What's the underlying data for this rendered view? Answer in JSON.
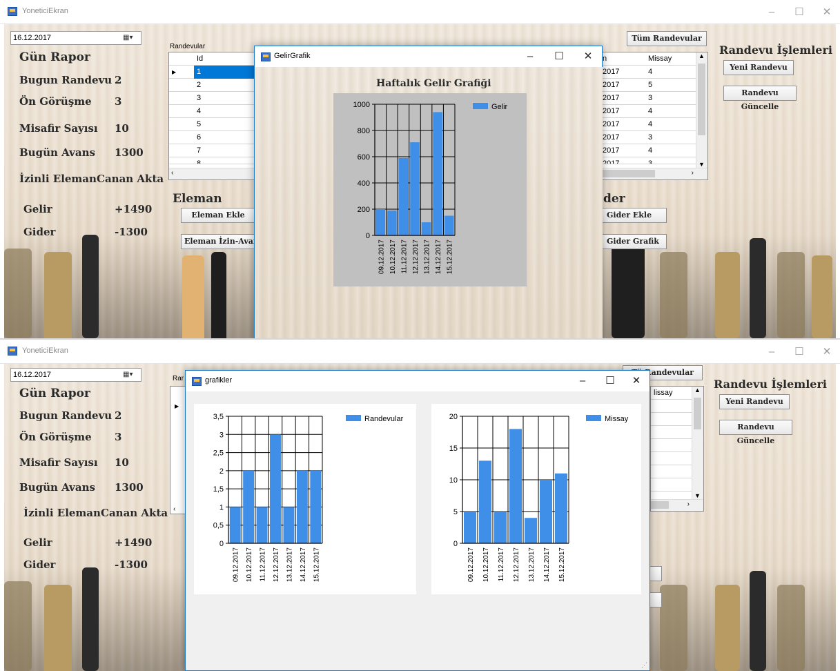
{
  "top": {
    "app_title": "YoneticiEkran",
    "date": "16.12.2017",
    "gun_rapor": "Gün Rapor",
    "stats": [
      {
        "label": "Bugun Randevu",
        "value": "2"
      },
      {
        "label": "Ön Görüşme",
        "value": "3"
      },
      {
        "label": "Misafir Sayısı",
        "value": "10"
      },
      {
        "label": "Bugün Avans",
        "value": "1300"
      },
      {
        "label": "İzinli Eleman",
        "value": "Canan Akta"
      },
      {
        "label": "Gelir",
        "value": "+1490"
      },
      {
        "label": "Gider",
        "value": "-1300"
      }
    ],
    "randevular_label": "Randevular",
    "grid_headers": [
      "Id",
      "Missay"
    ],
    "grid_left_ids": [
      "1",
      "2",
      "3",
      "4",
      "5",
      "6",
      "7",
      "8"
    ],
    "grid_right_dates": [
      "2017",
      "2017",
      "2017",
      "2017",
      "2017",
      "2017",
      "2017",
      "2017"
    ],
    "grid_right_missay": [
      "4",
      "5",
      "3",
      "4",
      "4",
      "3",
      "4",
      "3"
    ],
    "eleman_heading": "Eleman",
    "eleman_ekle": "Eleman Ekle",
    "eleman_izin": "Eleman İzin-Avans",
    "gider_heading": "der",
    "gider_ekle": "Gider Ekle",
    "gider_grafik": "Gider Grafik",
    "tum_randevular": "Tüm Randevular",
    "randevu_islemleri": "Randevu İşlemleri",
    "yeni_randevu": "Yeni Randevu",
    "randevu_guncelle": "Randevu Güncelle",
    "dialog": {
      "caption": "GelirGrafik",
      "chart_title": "Haftalık Gelir Grafiği"
    }
  },
  "bottom": {
    "app_title": "YoneticiEkran",
    "date": "16.12.2017",
    "gun_rapor": "Gün Rapor",
    "stats": [
      {
        "label": "Bugun Randevu",
        "value": "2"
      },
      {
        "label": "Ön Görüşme",
        "value": "3"
      },
      {
        "label": "Misafir Sayısı",
        "value": "10"
      },
      {
        "label": "Bugün Avans",
        "value": "1300"
      },
      {
        "label": "İzinli Eleman",
        "value": "Canan Akta"
      },
      {
        "label": "Gelir",
        "value": "+1490"
      },
      {
        "label": "Gider",
        "value": "-1300"
      }
    ],
    "randevular_partial": "Rar",
    "missay_partial": "lissay",
    "tum_randevular_partial": "Tü Randevular",
    "randevu_islemleri": "Randevu İşlemleri",
    "yeni_randevu": "Yeni Randevu",
    "randevu_guncelle": "Randevu Güncelle",
    "dialog": {
      "caption": "grafikler"
    }
  },
  "colors": {
    "bar": "#3f8ee8",
    "chart_bg_gray": "#c0c0c0",
    "accent_blue": "#0078d7"
  },
  "chart_data": [
    {
      "type": "bar",
      "title": "Haftalık Gelir Grafiği",
      "categories": [
        "09.12.2017",
        "10.12.2017",
        "11.12.2017",
        "12.12.2017",
        "13.12.2017",
        "14.12.2017",
        "15.12.2017"
      ],
      "series": [
        {
          "name": "Gelir",
          "values": [
            200,
            190,
            590,
            710,
            100,
            940,
            150
          ]
        }
      ],
      "ylim": [
        0,
        1000
      ],
      "yticks": [
        "0",
        "200",
        "400",
        "600",
        "800",
        "1000"
      ],
      "grid": true,
      "legend": "top-right"
    },
    {
      "type": "bar",
      "categories": [
        "09.12.2017",
        "10.12.2017",
        "11.12.2017",
        "12.12.2017",
        "13.12.2017",
        "14.12.2017",
        "15.12.2017"
      ],
      "series": [
        {
          "name": "Randevular",
          "values": [
            1,
            2,
            1,
            3,
            1,
            2,
            2
          ]
        }
      ],
      "ylim": [
        0,
        3.5
      ],
      "yticks": [
        "0",
        "0,5",
        "1",
        "1,5",
        "2",
        "2,5",
        "3",
        "3,5"
      ],
      "grid": true,
      "legend": "top-right"
    },
    {
      "type": "bar",
      "categories": [
        "09.12.2017",
        "10.12.2017",
        "11.12.2017",
        "12.12.2017",
        "13.12.2017",
        "14.12.2017",
        "15.12.2017"
      ],
      "series": [
        {
          "name": "Missay",
          "values": [
            5,
            13,
            5,
            18,
            4,
            10,
            11
          ]
        }
      ],
      "ylim": [
        0,
        20
      ],
      "yticks": [
        "0",
        "5",
        "10",
        "15",
        "20"
      ],
      "grid": true,
      "legend": "top-right"
    }
  ]
}
